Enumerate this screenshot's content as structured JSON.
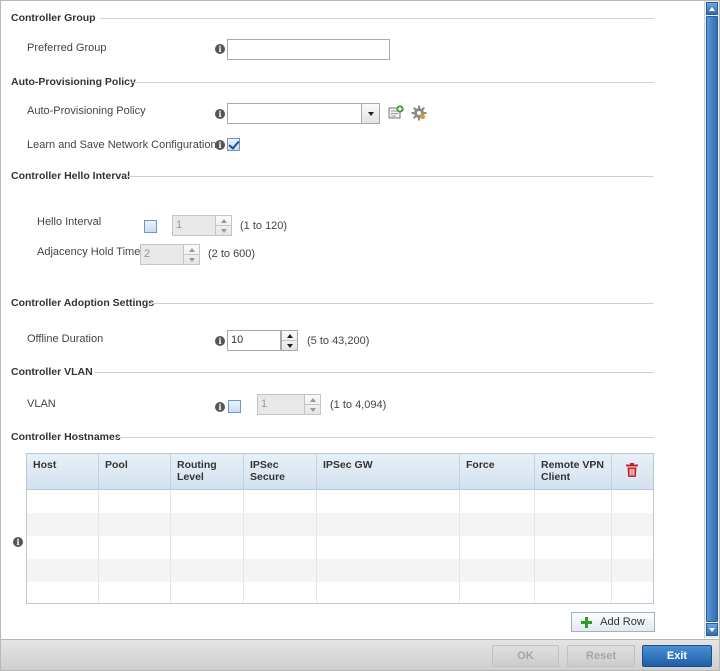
{
  "sections": {
    "controller_group": "Controller Group",
    "auto_provisioning": "Auto-Provisioning Policy",
    "hello_interval": "Controller Hello Interval",
    "adoption": "Controller Adoption Settings",
    "vlan": "Controller VLAN",
    "hostnames": "Controller Hostnames"
  },
  "fields": {
    "preferred_group": {
      "label": "Preferred Group",
      "value": ""
    },
    "auto_policy": {
      "label": "Auto-Provisioning Policy",
      "value": ""
    },
    "learn_save": {
      "label": "Learn and Save Network Configuration",
      "checked": true
    },
    "hello_interval": {
      "label": "Hello Interval",
      "value": "1",
      "range": "(1 to 120)",
      "enabled": false
    },
    "adjacency_hold": {
      "label": "Adjacency Hold Time",
      "value": "2",
      "range": "(2 to 600)"
    },
    "offline_duration": {
      "label": "Offline Duration",
      "value": "10",
      "range": "(5 to 43,200)"
    },
    "vlan": {
      "label": "VLAN",
      "value": "1",
      "range": "(1 to 4,094)",
      "enabled": false
    }
  },
  "table": {
    "columns": [
      {
        "line1": "Host",
        "line2": ""
      },
      {
        "line1": "Pool",
        "line2": ""
      },
      {
        "line1": "Routing",
        "line2": "Level"
      },
      {
        "line1": "IPSec",
        "line2": "Secure"
      },
      {
        "line1": "IPSec GW",
        "line2": ""
      },
      {
        "line1": "Force",
        "line2": ""
      },
      {
        "line1": "Remote VPN",
        "line2": "Client"
      }
    ],
    "rows": []
  },
  "buttons": {
    "add_row": "Add Row",
    "ok": "OK",
    "reset": "Reset",
    "exit": "Exit"
  },
  "colors": {
    "accent": "#2f6eb1",
    "delete_icon": "#c0262d",
    "add_icon": "#2e9a2e"
  },
  "icons": {
    "info": "info-icon",
    "create_policy": "create-icon",
    "edit_policy": "gear-icon",
    "delete_all": "trash-icon",
    "add_row": "plus-icon"
  }
}
